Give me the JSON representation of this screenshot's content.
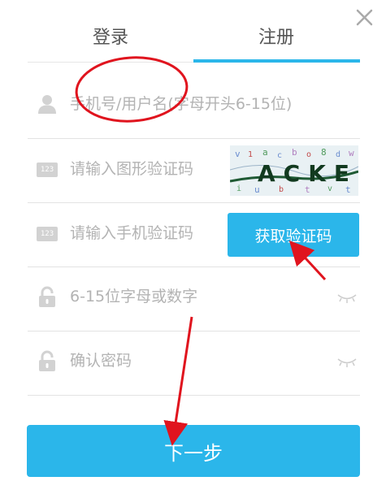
{
  "tabs": [
    {
      "label": "登录",
      "active": false
    },
    {
      "label": "注册",
      "active": true
    }
  ],
  "form": {
    "username_placeholder": "手机号/用户名(字母开头6-15位)",
    "image_code_placeholder": "请输入图形验证码",
    "captcha_text": "ACKE",
    "sms_code_placeholder": "请输入手机验证码",
    "get_code_label": "获取验证码",
    "password_placeholder": "6-15位字母或数字",
    "confirm_placeholder": "确认密码",
    "code_icon_text": "123"
  },
  "next_label": "下一步",
  "colors": {
    "accent": "#2bb6ea",
    "annotation": "#e0141e",
    "icon_gray": "#d2d2d2"
  },
  "icons": [
    "close-icon",
    "user-icon",
    "keypad-icon",
    "lock-icon",
    "eye-closed-icon"
  ]
}
